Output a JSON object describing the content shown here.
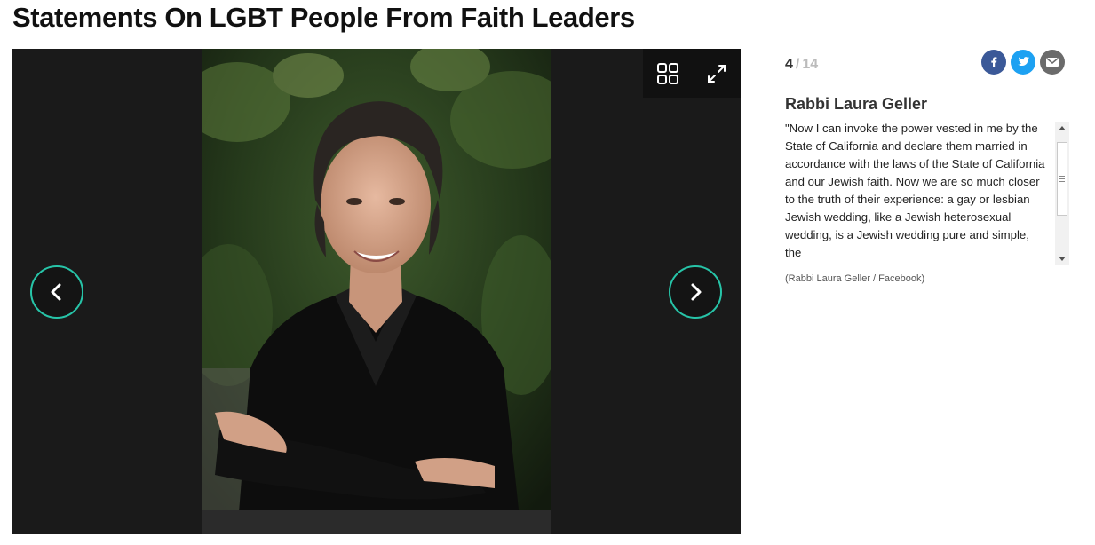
{
  "page": {
    "title": "Statements On LGBT People From Faith Leaders"
  },
  "gallery": {
    "controls": {
      "grid_icon": "grid-view-icon",
      "expand_icon": "expand-icon",
      "prev_icon": "chevron-left-icon",
      "next_icon": "chevron-right-icon"
    },
    "accent_color": "#27c4a8"
  },
  "sidebar": {
    "counter": {
      "current": "4",
      "separator": "/",
      "total": "14"
    },
    "share": [
      {
        "name": "facebook-icon",
        "color": "#3b5998"
      },
      {
        "name": "twitter-icon",
        "color": "#1da1f2"
      },
      {
        "name": "email-icon",
        "color": "#6b6b6b"
      }
    ],
    "slide_title": "Rabbi Laura Geller",
    "caption": "\"Now I can invoke the power vested in me by the State of California and declare them married in accordance with the laws of the State of California and our Jewish faith. Now we are so much closer to the truth of their experience: a gay or lesbian Jewish wedding, like a Jewish heterosexual wedding, is a Jewish wedding pure and simple, the",
    "credit": "(Rabbi Laura Geller / Facebook)"
  }
}
